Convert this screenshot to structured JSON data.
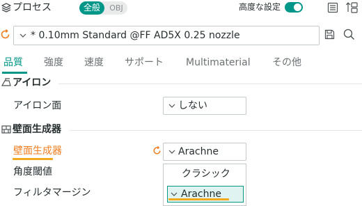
{
  "header": {
    "title": "プロセス",
    "scope_toggle": {
      "global_label": "全般",
      "object_label": "OBJ",
      "selected": "global"
    },
    "advanced_label": "高度な設定",
    "advanced_enabled": true
  },
  "preset": {
    "value": "* 0.10mm Standard @FF AD5X 0.25 nozzle"
  },
  "tabs": [
    {
      "label": "品質",
      "active": true
    },
    {
      "label": "強度",
      "active": false
    },
    {
      "label": "速度",
      "active": false
    },
    {
      "label": "サポート",
      "active": false
    },
    {
      "label": "Multimaterial",
      "active": false
    },
    {
      "label": "その他",
      "active": false
    }
  ],
  "sections": {
    "ironing": {
      "title": "アイロン",
      "ironing_type": {
        "label": "アイロン面",
        "value": "しない"
      }
    },
    "wall_generator": {
      "title": "壁面生成器",
      "wall_generator": {
        "label": "壁面生成器",
        "value": "Arachne",
        "modified": true
      },
      "angle_threshold": {
        "label": "角度閾値"
      },
      "filter_margin": {
        "label": "フィルタマージン"
      }
    }
  },
  "dropdown": {
    "options": [
      "クラシック",
      "Arachne"
    ],
    "selected": "Arachne"
  },
  "colors": {
    "accent": "#009688",
    "modified": "#f07c1e",
    "highlight_underline": "#f4a81d",
    "text": "#262e30"
  },
  "icons": {
    "header": [
      "process-icon",
      "list-icon",
      "compare-icon"
    ],
    "preset": [
      "reset-icon",
      "save-icon",
      "search-icon"
    ]
  }
}
